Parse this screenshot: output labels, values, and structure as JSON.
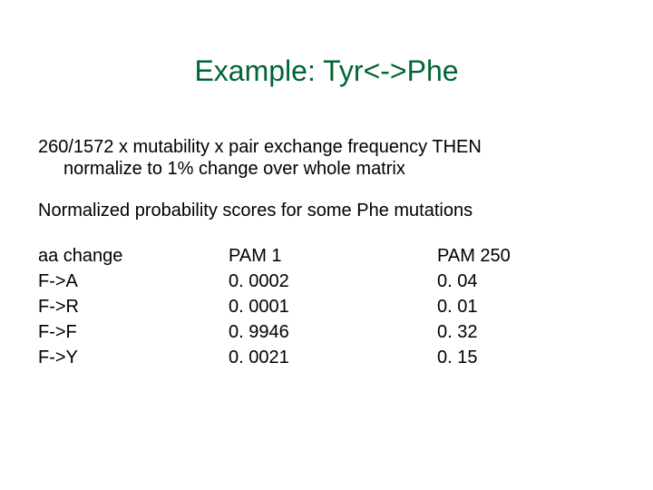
{
  "title": "Example: Tyr<->Phe",
  "para1_line1": "260/1572 x mutability x pair exchange frequency THEN",
  "para1_line2": "normalize to 1% change over whole matrix",
  "para2": "Normalized probability scores for some Phe mutations",
  "chart_data": {
    "type": "table",
    "title": "Normalized probability scores for some Phe mutations",
    "columns": [
      "aa change",
      "PAM 1",
      "PAM 250"
    ],
    "rows": [
      {
        "aa_change": "F->A",
        "pam1": "0. 0002",
        "pam250": "0. 04"
      },
      {
        "aa_change": "F->R",
        "pam1": "0. 0001",
        "pam250": "0. 01"
      },
      {
        "aa_change": "F->F",
        "pam1": "0. 9946",
        "pam250": "0. 32"
      },
      {
        "aa_change": "F->Y",
        "pam1": "0. 0021",
        "pam250": "0. 15"
      }
    ]
  }
}
